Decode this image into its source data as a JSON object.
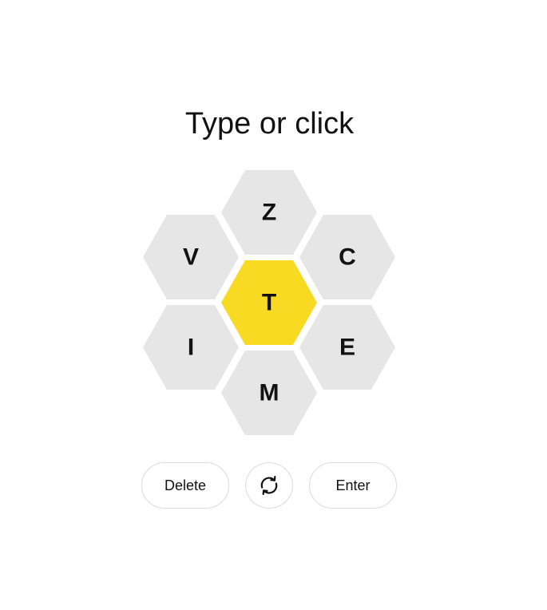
{
  "prompt": "Type or click",
  "hive": {
    "letters": [
      "Z",
      "V",
      "C",
      "T",
      "I",
      "E",
      "M"
    ],
    "center_letter": "T",
    "colors": {
      "center": "#f7da21",
      "outer": "#e6e6e6"
    }
  },
  "buttons": {
    "delete_label": "Delete",
    "shuffle_icon": "shuffle-icon",
    "enter_label": "Enter"
  }
}
